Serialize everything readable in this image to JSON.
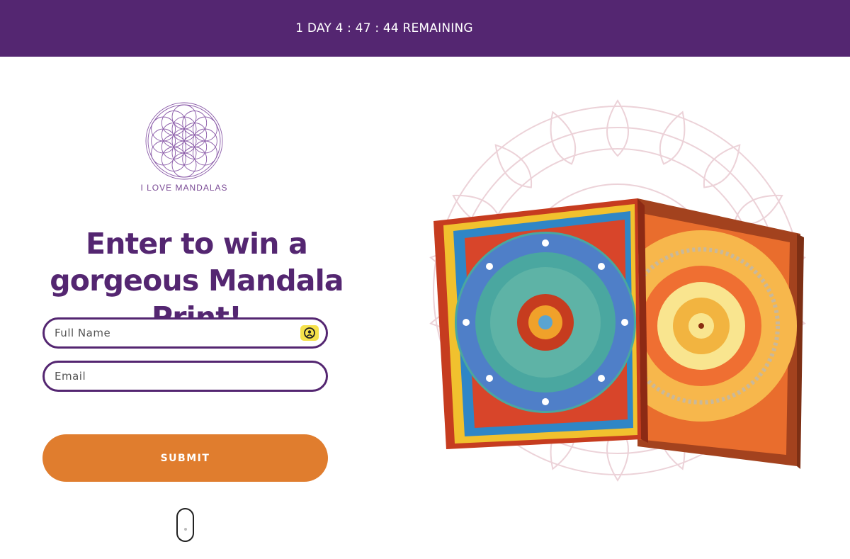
{
  "countdown": {
    "text": "1 DAY  4 : 47 : 44 REMAINING",
    "color": "#542671"
  },
  "logo": {
    "text": "I LOVE MANDALAS",
    "icon": "flower-of-life-icon"
  },
  "headline": "Enter to win a gorgeous Mandala Print!",
  "form": {
    "name_placeholder": "Full Name",
    "email_placeholder": "Email",
    "submit_label": "SUBMIT",
    "submit_color": "#e07d2e",
    "autofill_icon": "autofill-contact-icon"
  },
  "hero": {
    "description_icon": "mandala-canvas-prints-image"
  }
}
